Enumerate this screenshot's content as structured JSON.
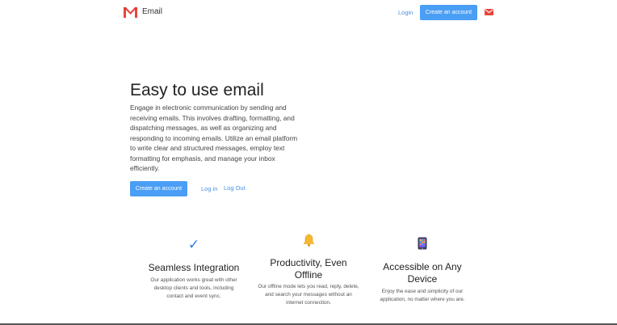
{
  "header": {
    "logo_icon": "gmail-m-logo",
    "brand": "Email",
    "login_label": "Login",
    "create_account_label": "Create an account",
    "mail_icon": "envelope-icon",
    "accent_color": "#4a9ef5",
    "brand_color": "#e8453c"
  },
  "hero": {
    "title": "Easy to use email",
    "description": "Engage in electronic communication by sending and receiving emails. This involves drafting, formatting, and dispatching messages, as well as organizing and responding to incoming emails. Utilize an email platform to write clear and structured messages, employ text formatting for emphasis, and manage your inbox efficiently.",
    "create_account_label": "Create an account",
    "login_label": "Log in",
    "logout_label": "Log Out"
  },
  "features": [
    {
      "icon": "check-mark-icon",
      "icon_glyph": "✓",
      "title": "Seamless Integration",
      "text": "Our application works great with other desktop clients and tools, including contact and event sync."
    },
    {
      "icon": "bell-icon",
      "title": "Productivity, Even Offline",
      "text": "Our offline mode lets you read, reply, delete, and search your messages without an internet connection."
    },
    {
      "icon": "mobile-phone-icon",
      "title": "Accessible on Any Device",
      "text": "Enjoy the ease and simplicity of our application, no matter where you are."
    }
  ]
}
